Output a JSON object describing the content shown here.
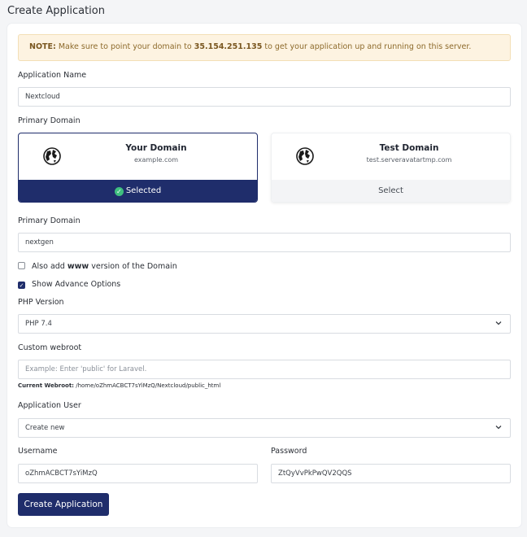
{
  "page": {
    "title": "Create Application"
  },
  "notice": {
    "label": "NOTE:",
    "text_before": "Make sure to point your domain to",
    "ip": "35.154.251.135",
    "text_after": "to get your application up and running on this server."
  },
  "app_name": {
    "label": "Application Name",
    "value": "Nextcloud"
  },
  "primary_domain_choice": {
    "label": "Primary Domain",
    "options": [
      {
        "title": "Your Domain",
        "subtitle": "example.com",
        "action": "Selected",
        "icon": "globe-icon",
        "state": "selected"
      },
      {
        "title": "Test Domain",
        "subtitle": "test.serveravatartmp.com",
        "action": "Select",
        "icon": "globe-icon",
        "state": "unselected"
      }
    ]
  },
  "primary_domain": {
    "label": "Primary Domain",
    "value": "nextgen"
  },
  "www_option": {
    "text_before": "Also add",
    "bold": "www",
    "text_after": "version of the Domain",
    "checked": false
  },
  "advance_option": {
    "label": "Show Advance Options",
    "checked": true
  },
  "php_version": {
    "label": "PHP Version",
    "value": "PHP 7.4"
  },
  "webroot": {
    "label": "Custom webroot",
    "placeholder": "Example: Enter 'public' for Laravel.",
    "hint_label": "Current Webroot:",
    "hint_value": "/home/oZhmACBCT7sYiMzQ/Nextcloud/public_html"
  },
  "app_user": {
    "label": "Application User",
    "value": "Create new"
  },
  "username": {
    "label": "Username",
    "value": "oZhmACBCT7sYiMzQ"
  },
  "password": {
    "label": "Password",
    "value": "ZtQyVvPkPwQV2QQS"
  },
  "submit": {
    "label": "Create Application"
  },
  "colors": {
    "primary": "#1f2d6b",
    "notice_bg": "#fdf3e1",
    "success": "#3fbf7f"
  }
}
